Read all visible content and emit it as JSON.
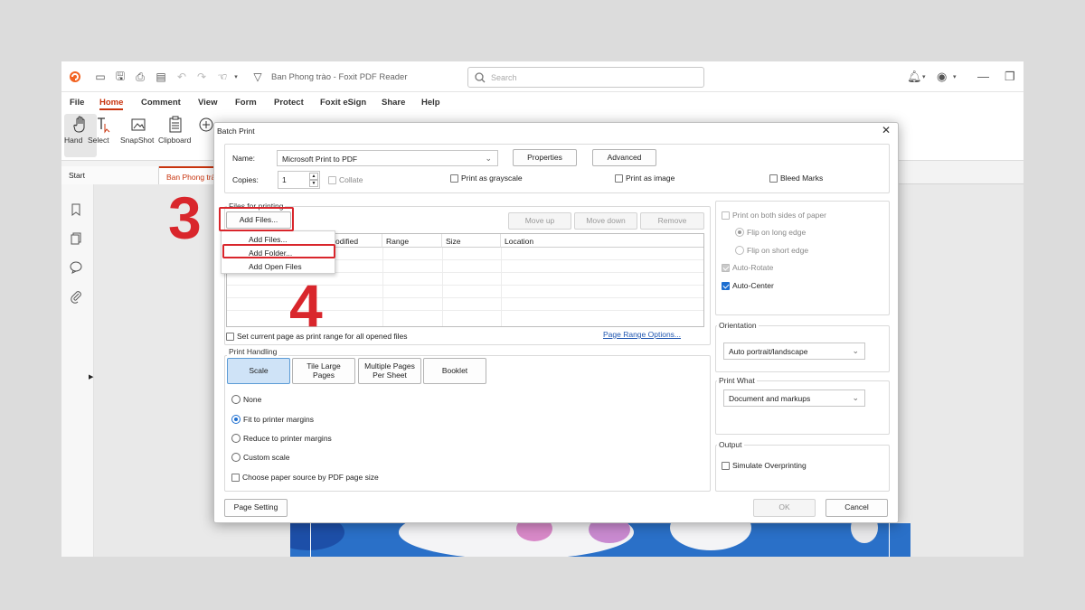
{
  "window": {
    "title": "Ban Phong trào - Foxit PDF Reader",
    "search_placeholder": "Search"
  },
  "menu": [
    "File",
    "Home",
    "Comment",
    "View",
    "Form",
    "Protect",
    "Foxit eSign",
    "Share",
    "Help"
  ],
  "ribbon": {
    "hand": "Hand",
    "select": "Select",
    "snapshot": "SnapShot",
    "clipboard": "Clipboard",
    "zoom": "Zo"
  },
  "tabs": [
    "Start",
    "Ban Phong trà"
  ],
  "dialog": {
    "title": "Batch Print",
    "name_label": "Name:",
    "printer": "Microsoft Print to PDF",
    "properties": "Properties",
    "advanced": "Advanced",
    "copies_label": "Copies:",
    "copies_value": "1",
    "collate": "Collate",
    "print_grayscale": "Print as grayscale",
    "print_image": "Print as image",
    "bleed_marks": "Bleed Marks",
    "files_group": "Files for printing",
    "add_files": "Add Files...",
    "move_up": "Move up",
    "move_down": "Move down",
    "remove": "Remove",
    "columns": [
      "odified",
      "Range",
      "Size",
      "Location"
    ],
    "context_menu": [
      "Add Files...",
      "Add Folder...",
      "Add Open Files"
    ],
    "set_current_page": "Set current page as print range for all opened files",
    "page_range_options": "Page Range Options...",
    "print_handling": "Print Handling",
    "handling_tabs": [
      "Scale",
      "Tile Large\nPages",
      "Multiple Pages\nPer Sheet",
      "Booklet"
    ],
    "scale_options": [
      "None",
      "Fit to printer margins",
      "Reduce to printer margins",
      "Custom scale"
    ],
    "paper_source": "Choose paper source by PDF page size",
    "duplex": "Print on both sides of paper",
    "flip_long": "Flip on long edge",
    "flip_short": "Flip on short edge",
    "auto_rotate": "Auto-Rotate",
    "auto_center": "Auto-Center",
    "orientation_label": "Orientation",
    "orientation_value": "Auto portrait/landscape",
    "print_what_label": "Print What",
    "print_what_value": "Document and markups",
    "output_label": "Output",
    "simulate_overprinting": "Simulate Overprinting",
    "page_setting": "Page Setting",
    "ok": "OK",
    "cancel": "Cancel"
  },
  "annotations": {
    "step3": "3",
    "step4": "4"
  },
  "colors": {
    "brand": "#c8340e",
    "highlight": "#d9262c",
    "accent": "#1e6fd0"
  }
}
